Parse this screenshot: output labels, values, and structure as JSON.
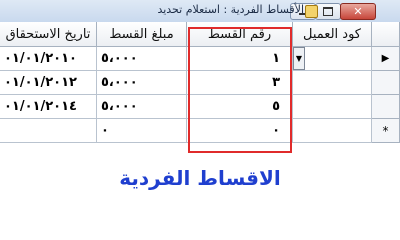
{
  "window": {
    "title": "الأقساط الفردية : استعلام تحديد",
    "close_glyph": "✕",
    "max_icon": "maximize-icon",
    "min_icon": "minimize-icon"
  },
  "grid": {
    "columns": {
      "customer_code": "كود العميل",
      "installment_no": "رقم القسط",
      "amount": "مبلغ القسط",
      "due_date": "تاريخ الاستحقاق"
    },
    "rows": [
      {
        "selector": "▶",
        "customer_code": "",
        "installment_no": "١",
        "amount": "٥،٠٠٠",
        "due_date": "٠١/٠١/٢٠١٠"
      },
      {
        "selector": "",
        "customer_code": "",
        "installment_no": "٣",
        "amount": "٥،٠٠٠",
        "due_date": "٠١/٠١/٢٠١٢"
      },
      {
        "selector": "",
        "customer_code": "",
        "installment_no": "٥",
        "amount": "٥،٠٠٠",
        "due_date": "٠١/٠١/٢٠١٤"
      },
      {
        "selector": "*",
        "customer_code": "",
        "installment_no": "٠",
        "amount": "٠",
        "due_date": ""
      }
    ],
    "dropdown_glyph": "▼"
  },
  "caption": "الاقساط الفردية",
  "colors": {
    "highlight": "#e02b2b",
    "caption": "#1f3fcf"
  }
}
